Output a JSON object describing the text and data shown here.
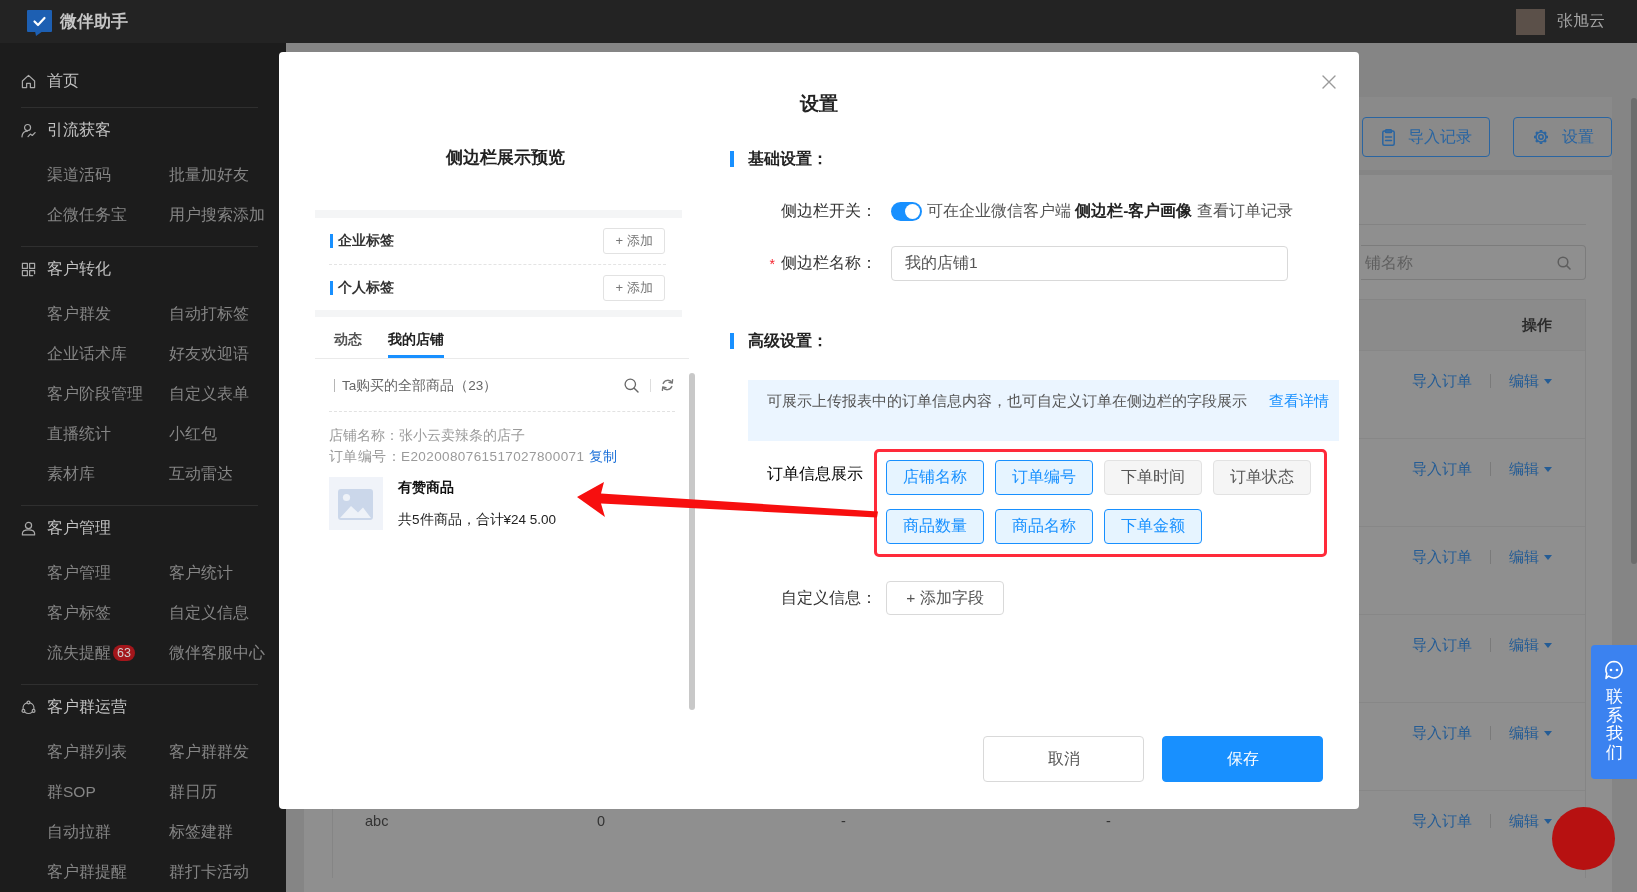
{
  "topbar": {
    "app_name": "微伴助手",
    "user": "张旭云"
  },
  "sidebar": {
    "sections": [
      {
        "title": "首页"
      },
      {
        "title": "引流获客",
        "items": [
          {
            "label": "渠道活码"
          },
          {
            "label": "批量加好友"
          },
          {
            "label": "企微任务宝"
          },
          {
            "label": "用户搜索添加"
          }
        ]
      },
      {
        "title": "客户转化",
        "items": [
          {
            "label": "客户群发"
          },
          {
            "label": "自动打标签"
          },
          {
            "label": "企业话术库"
          },
          {
            "label": "好友欢迎语"
          },
          {
            "label": "客户阶段管理"
          },
          {
            "label": "自定义表单"
          },
          {
            "label": "直播统计"
          },
          {
            "label": "小红包"
          },
          {
            "label": "素材库"
          },
          {
            "label": "互动雷达"
          }
        ]
      },
      {
        "title": "客户管理",
        "items": [
          {
            "label": "客户管理"
          },
          {
            "label": "客户统计"
          },
          {
            "label": "客户标签"
          },
          {
            "label": "自定义信息"
          },
          {
            "label": "流失提醒",
            "badge": "63"
          },
          {
            "label": "微伴客服中心"
          }
        ]
      },
      {
        "title": "客户群运营",
        "items": [
          {
            "label": "客户群列表"
          },
          {
            "label": "客户群群发"
          },
          {
            "label": "群SOP"
          },
          {
            "label": "群日历"
          },
          {
            "label": "自动拉群"
          },
          {
            "label": "标签建群"
          },
          {
            "label": "客户群提醒"
          },
          {
            "label": "群打卡活动"
          }
        ]
      }
    ]
  },
  "page": {
    "buttons": [
      {
        "label": "导入记录"
      },
      {
        "label": "设置"
      }
    ],
    "search": {
      "placeholder": "铺名称"
    },
    "table": {
      "action_header": "操作",
      "rows": [
        {
          "import": "导入订单",
          "edit": "编辑"
        },
        {
          "import": "导入订单",
          "edit": "编辑"
        },
        {
          "import": "导入订单",
          "edit": "编辑"
        },
        {
          "import": "导入订单",
          "edit": "编辑"
        },
        {
          "import": "导入订单",
          "edit": "编辑"
        },
        {
          "cells": [
            "abc",
            "0",
            "-",
            "-"
          ],
          "import": "导入订单",
          "edit": "编辑"
        }
      ]
    }
  },
  "dialog": {
    "title": "设置",
    "preview": {
      "title": "侧边栏展示预览",
      "tag_groups": [
        {
          "label": "企业标签",
          "button": "+ 添加"
        },
        {
          "label": "个人标签",
          "button": "+ 添加"
        }
      ],
      "tabs": [
        {
          "label": "动态",
          "selected": false
        },
        {
          "label": "我的店铺",
          "selected": true
        }
      ],
      "list_title": "Ta购买的全部商品（23）",
      "order": {
        "shop": "店铺名称：张小云卖辣条的店子",
        "number": "订单编号：E2020080761517027800071",
        "copy": "复制",
        "product": "有赞商品",
        "summary": "共5件商品，合计¥24 5.00"
      }
    },
    "basic": {
      "heading": "基础设置：",
      "switch": {
        "label": "侧边栏开关：",
        "on": true,
        "description": "可在企业微信客户端 **侧边栏-客户画像** 查看订单记录"
      },
      "name_field": {
        "required_mark": "*",
        "label": "侧边栏名称：",
        "value": "我的店铺1"
      }
    },
    "advanced": {
      "heading": "高级设置：",
      "notice": {
        "text": "可展示上传报表中的订单信息内容，也可自定义订单在侧边栏的字段展示",
        "link": "查看详情"
      },
      "order_fields": {
        "label": "订单信息展示",
        "options": [
          {
            "label": "店铺名称",
            "selected": true
          },
          {
            "label": "订单编号",
            "selected": true
          },
          {
            "label": "下单时间",
            "selected": false
          },
          {
            "label": "订单状态",
            "selected": false
          },
          {
            "label": "商品数量",
            "selected": true
          },
          {
            "label": "商品名称",
            "selected": true
          },
          {
            "label": "下单金额",
            "selected": true
          }
        ]
      },
      "custom": {
        "label": "自定义信息：",
        "button": "+ 添加字段"
      }
    },
    "buttons": [
      {
        "label": "取消",
        "kind": "default"
      },
      {
        "label": "保存",
        "kind": "primary"
      }
    ]
  },
  "contact": {
    "label": "联系我们"
  }
}
